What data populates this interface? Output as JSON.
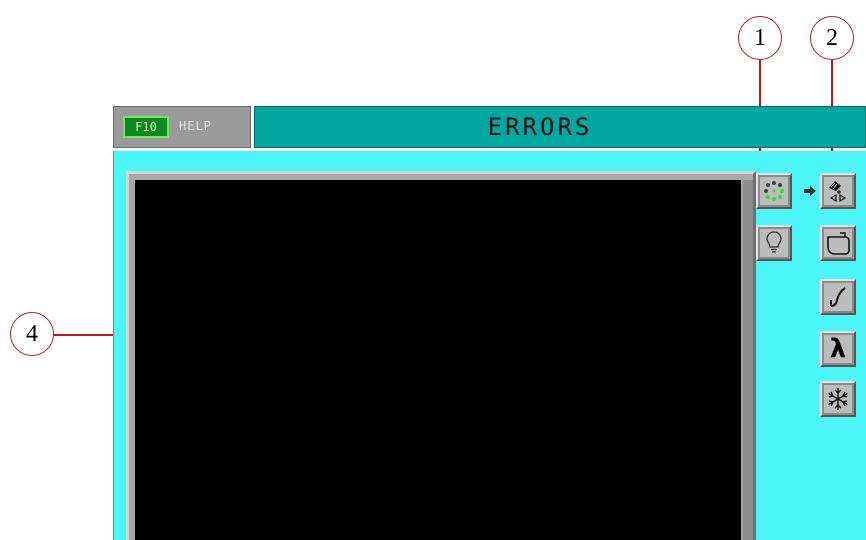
{
  "callouts": [
    "1",
    "2",
    "4"
  ],
  "header": {
    "help_key": "F10",
    "help_label": "HELP",
    "title": "ERRORS"
  },
  "tools": {
    "left_column": [
      "error-indicator-icon",
      "lightbulb-icon"
    ],
    "right_column": [
      "robot-arm-icon",
      "mold-icon",
      "curve-icon",
      "lambda-icon",
      "snowflake-icon"
    ],
    "lambda_glyph": "λ"
  },
  "colors": {
    "panel": "#4cf6f8",
    "title_bar": "#00a6a0",
    "screen": "#000000",
    "f10_key": "#0a8a1e",
    "callout": "#c01818"
  }
}
